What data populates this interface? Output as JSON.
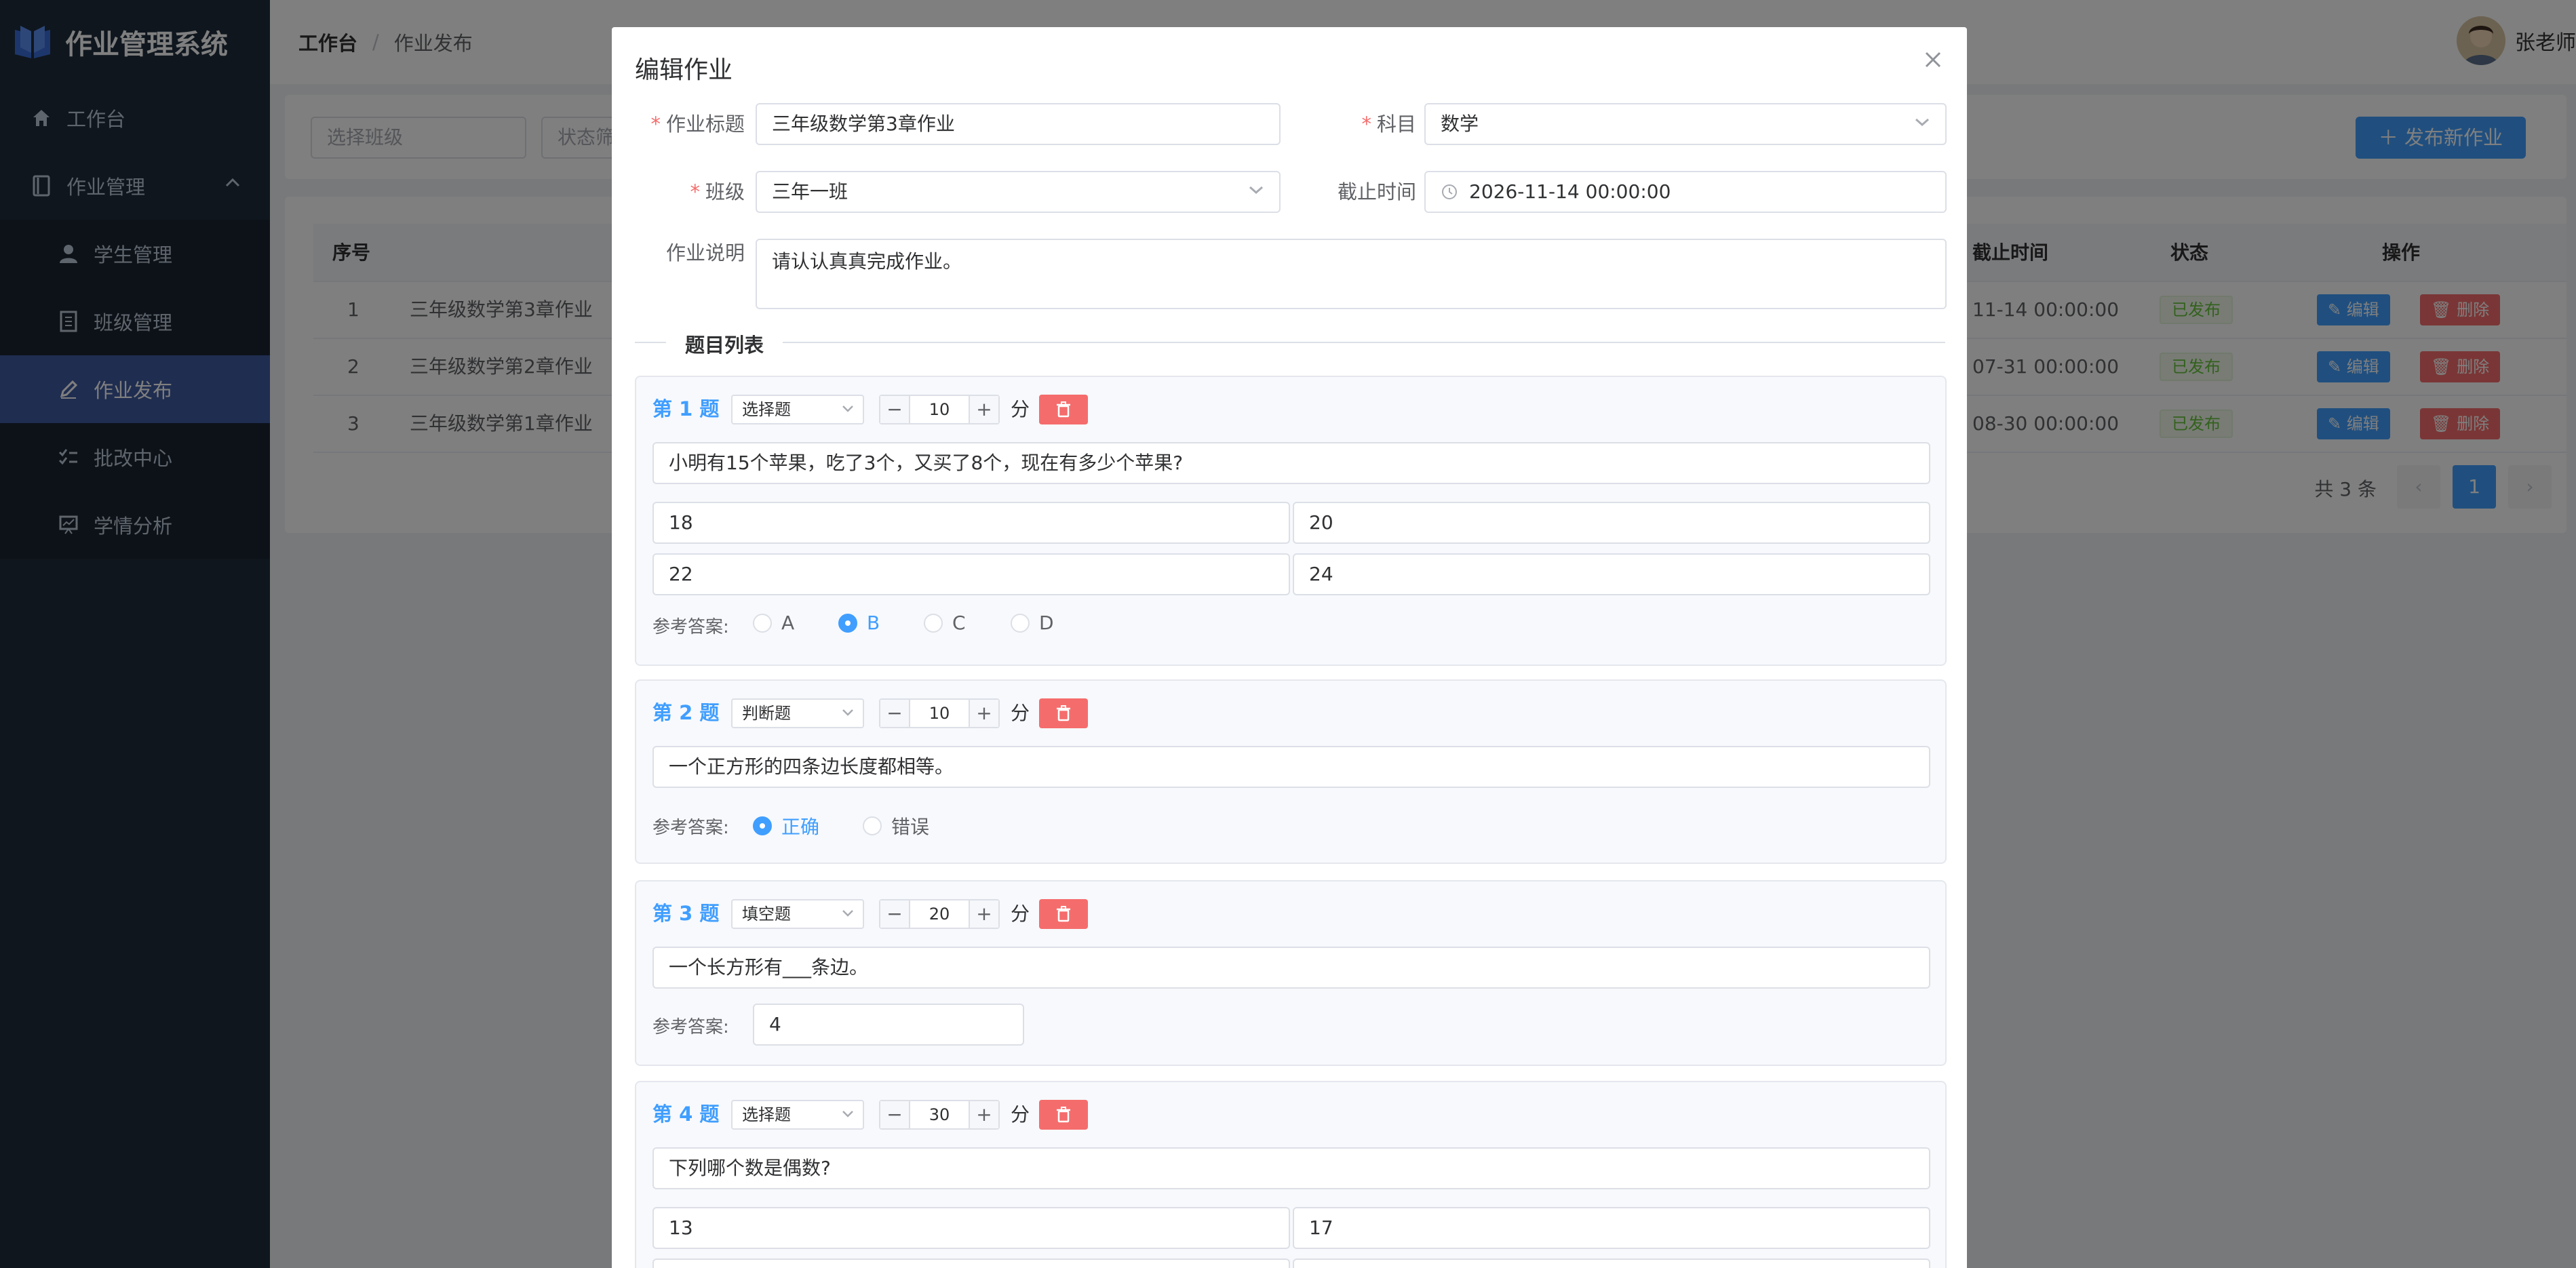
{
  "app": {
    "title": "作业管理系统"
  },
  "sidebar": {
    "workbench": "工作台",
    "homework_mgmt": "作业管理",
    "items": [
      {
        "label": "学生管理"
      },
      {
        "label": "班级管理"
      },
      {
        "label": "作业发布"
      },
      {
        "label": "批改中心"
      },
      {
        "label": "学情分析"
      }
    ]
  },
  "header": {
    "breadcrumb_root": "工作台",
    "breadcrumb_current": "作业发布",
    "user_name": "张老师"
  },
  "filters": {
    "class_placeholder": "选择班级",
    "status_placeholder": "状态筛",
    "publish_button": "发布新作业"
  },
  "table": {
    "headers": {
      "index": "序号",
      "deadline": "截止时间",
      "status": "状态",
      "actions": "操作"
    },
    "rows": [
      {
        "index": "1",
        "title": "三年级数学第3章作业",
        "deadline": "11-14 00:00:00",
        "status": "已发布"
      },
      {
        "index": "2",
        "title": "三年级数学第2章作业",
        "deadline": "07-31 00:00:00",
        "status": "已发布"
      },
      {
        "index": "3",
        "title": "三年级数学第1章作业",
        "deadline": "08-30 00:00:00",
        "status": "已发布"
      }
    ],
    "edit_label": "编辑",
    "delete_label": "删除",
    "total": "共 3 条",
    "current_page": "1"
  },
  "dialog": {
    "title": "编辑作业",
    "fields": {
      "title_label": "作业标题",
      "title_value": "三年级数学第3章作业",
      "subject_label": "科目",
      "subject_value": "数学",
      "class_label": "班级",
      "class_value": "三年一班",
      "deadline_label": "截止时间",
      "deadline_value": "2026-11-14 00:00:00",
      "desc_label": "作业说明",
      "desc_value": "请认认真真完成作业。"
    },
    "question_list_title": "题目列表",
    "score_unit": "分",
    "answer_label": "参考答案:",
    "questions": [
      {
        "number": "第 1 题",
        "type": "选择题",
        "score": "10",
        "content": "小明有15个苹果，吃了3个，又买了8个，现在有多少个苹果?",
        "options": [
          "18",
          "20",
          "22",
          "24"
        ],
        "choices": [
          "A",
          "B",
          "C",
          "D"
        ],
        "answer": "B"
      },
      {
        "number": "第 2 题",
        "type": "判断题",
        "score": "10",
        "content": "一个正方形的四条边长度都相等。",
        "choices": [
          "正确",
          "错误"
        ],
        "answer": "正确"
      },
      {
        "number": "第 3 题",
        "type": "填空题",
        "score": "20",
        "content": "一个长方形有___条边。",
        "answer": "4"
      },
      {
        "number": "第 4 题",
        "type": "选择题",
        "score": "30",
        "content": "下列哪个数是偶数?",
        "options": [
          "13",
          "17"
        ]
      }
    ]
  },
  "colors": {
    "primary": "#409eff",
    "danger": "#f56c6c",
    "success": "#67c23a",
    "sidebar_bg": "#1f2d3d",
    "sidebar_active": "#3f5aa0"
  }
}
